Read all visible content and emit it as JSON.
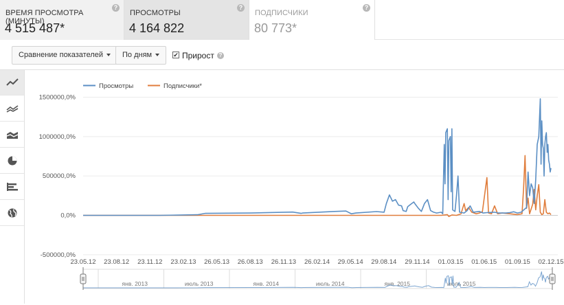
{
  "metrics": [
    {
      "label": "ВРЕМЯ ПРОСМОТРА (МИНУТЫ)",
      "value": "4 515 487*"
    },
    {
      "label": "ПРОСМОТРЫ",
      "value": "4 164 822"
    },
    {
      "label": "ПОДПИСЧИКИ",
      "value": "80 773*"
    }
  ],
  "help_glyph": "?",
  "controls": {
    "compare_label": "Сравнение показателей",
    "period_label": "По дням",
    "growth_label": "Прирост",
    "growth_checked": true,
    "check_glyph": "✔"
  },
  "sidebar_icons": [
    "line-chart-icon",
    "multi-line-chart-icon",
    "stacked-area-chart-icon",
    "pie-chart-icon",
    "bar-chart-icon",
    "globe-map-icon"
  ],
  "colors": {
    "views": "#5b8fc4",
    "subscribers": "#e07d3c"
  },
  "chart_data": {
    "type": "line",
    "y_ticks": [
      "1500000,0%",
      "1000000,0%",
      "500000,0%",
      "0,0%",
      "-500000,0%"
    ],
    "y_values": [
      1500000,
      1000000,
      500000,
      0,
      -500000
    ],
    "ylim": [
      -500000,
      1500000
    ],
    "x_ticks": [
      "23.05.12",
      "23.08.12",
      "23.11.12",
      "23.02.13",
      "26.05.13",
      "26.08.13",
      "26.11.13",
      "26.02.14",
      "29.05.14",
      "29.08.14",
      "29.11.14",
      "01.03.15",
      "01.06.15",
      "01.09.15",
      "02.12.15"
    ],
    "navigator_ticks": [
      "янв. 2013",
      "июль 2013",
      "янв. 2014",
      "июль 2014",
      "янв. 2015",
      "июль 2015"
    ],
    "series": [
      {
        "name": "Просмотры",
        "color": "#5b8fc4",
        "points": [
          [
            0,
            0
          ],
          [
            40,
            0
          ],
          [
            100,
            0
          ],
          [
            150,
            8000
          ],
          [
            160,
            25000
          ],
          [
            220,
            30000
          ],
          [
            275,
            42000
          ],
          [
            286,
            25000
          ],
          [
            288,
            30000
          ],
          [
            330,
            50000
          ],
          [
            345,
            55000
          ],
          [
            352,
            20000
          ],
          [
            358,
            30000
          ],
          [
            385,
            48000
          ],
          [
            395,
            40000
          ],
          [
            398,
            150000
          ],
          [
            402,
            260000
          ],
          [
            406,
            180000
          ],
          [
            410,
            200000
          ],
          [
            414,
            130000
          ],
          [
            418,
            120000
          ],
          [
            420,
            60000
          ],
          [
            424,
            50000
          ],
          [
            426,
            110000
          ],
          [
            430,
            140000
          ],
          [
            434,
            170000
          ],
          [
            436,
            140000
          ],
          [
            440,
            90000
          ],
          [
            444,
            50000
          ],
          [
            448,
            150000
          ],
          [
            452,
            200000
          ],
          [
            456,
            60000
          ],
          [
            460,
            40000
          ],
          [
            464,
            30000
          ],
          [
            470,
            40000
          ],
          [
            472,
            20000
          ],
          [
            474,
            900000
          ],
          [
            475,
            400000
          ],
          [
            476,
            1050000
          ],
          [
            478,
            1100000
          ],
          [
            479,
            200000
          ],
          [
            480,
            950000
          ],
          [
            482,
            1000000
          ],
          [
            483,
            300000
          ],
          [
            484,
            1100000
          ],
          [
            485,
            70000
          ],
          [
            488,
            50000
          ],
          [
            490,
            250000
          ],
          [
            492,
            500000
          ],
          [
            494,
            40000
          ],
          [
            500,
            30000
          ],
          [
            504,
            60000
          ],
          [
            508,
            120000
          ],
          [
            512,
            40000
          ],
          [
            520,
            50000
          ],
          [
            525,
            30000
          ],
          [
            530,
            35000
          ],
          [
            540,
            40000
          ],
          [
            545,
            30000
          ],
          [
            555,
            30000
          ],
          [
            560,
            35000
          ],
          [
            565,
            45000
          ],
          [
            570,
            30000
          ],
          [
            575,
            40000
          ],
          [
            582,
            100000
          ],
          [
            584,
            550000
          ],
          [
            586,
            250000
          ],
          [
            588,
            400000
          ],
          [
            590,
            350000
          ],
          [
            592,
            150000
          ],
          [
            594,
            450000
          ],
          [
            596,
            900000
          ],
          [
            598,
            1000000
          ],
          [
            600,
            1480000
          ],
          [
            601,
            650000
          ],
          [
            602,
            1200000
          ],
          [
            603,
            900000
          ],
          [
            604,
            850000
          ],
          [
            605,
            500000
          ],
          [
            606,
            900000
          ],
          [
            607,
            1000000
          ],
          [
            608,
            1050000
          ],
          [
            609,
            800000
          ],
          [
            610,
            900000
          ],
          [
            611,
            700000
          ],
          [
            612,
            650000
          ],
          [
            613,
            550000
          ],
          [
            614,
            600000
          ]
        ]
      },
      {
        "name": "Подписчики*",
        "color": "#e07d3c",
        "points": [
          [
            0,
            0
          ],
          [
            60,
            0
          ],
          [
            120,
            0
          ],
          [
            180,
            0
          ],
          [
            240,
            0
          ],
          [
            300,
            0
          ],
          [
            360,
            0
          ],
          [
            420,
            0
          ],
          [
            470,
            0
          ],
          [
            478,
            10000
          ],
          [
            480,
            -15000
          ],
          [
            484,
            5000
          ],
          [
            490,
            0
          ],
          [
            496,
            20000
          ],
          [
            500,
            150000
          ],
          [
            502,
            60000
          ],
          [
            506,
            100000
          ],
          [
            510,
            40000
          ],
          [
            516,
            20000
          ],
          [
            520,
            30000
          ],
          [
            524,
            45000
          ],
          [
            530,
            480000
          ],
          [
            532,
            30000
          ],
          [
            536,
            20000
          ],
          [
            540,
            120000
          ],
          [
            544,
            20000
          ],
          [
            550,
            30000
          ],
          [
            560,
            20000
          ],
          [
            570,
            10000
          ],
          [
            576,
            20000
          ],
          [
            578,
            330000
          ],
          [
            580,
            760000
          ],
          [
            582,
            90000
          ],
          [
            584,
            220000
          ],
          [
            586,
            20000
          ],
          [
            590,
            140000
          ],
          [
            592,
            330000
          ],
          [
            594,
            70000
          ],
          [
            596,
            250000
          ],
          [
            598,
            390000
          ],
          [
            600,
            40000
          ],
          [
            602,
            10000
          ],
          [
            604,
            20000
          ],
          [
            606,
            200000
          ],
          [
            608,
            40000
          ],
          [
            610,
            20000
          ],
          [
            612,
            30000
          ],
          [
            614,
            10000
          ]
        ]
      }
    ]
  }
}
